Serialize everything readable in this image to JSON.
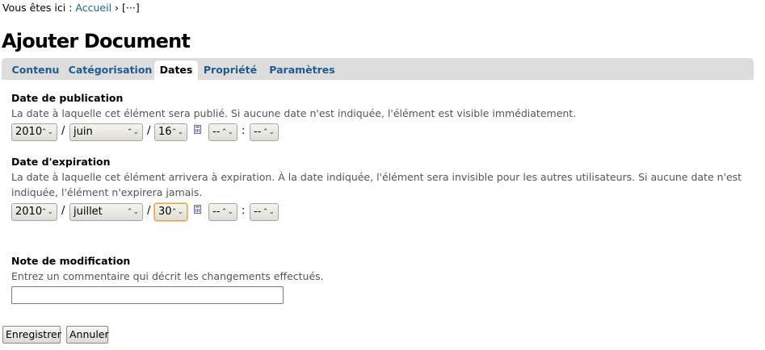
{
  "breadcrumb": {
    "prefix": "Vous êtes ici :",
    "home": "Accueil",
    "separator": "›",
    "current": "[···]"
  },
  "page_title": "Ajouter Document",
  "tabs": [
    {
      "label": "Contenu",
      "selected": false
    },
    {
      "label": "Catégorisation",
      "selected": false
    },
    {
      "label": "Dates",
      "selected": true
    },
    {
      "label": "Propriété",
      "selected": false
    },
    {
      "label": "Paramètres",
      "selected": false
    }
  ],
  "publication": {
    "label": "Date de publication",
    "help": "La date à laquelle cet élément sera publié. Si aucune date n'est indiquée, l'élément est visible immédiatement.",
    "year": "2010",
    "month": "juin",
    "day": "16",
    "hour": "--",
    "minute": "--"
  },
  "expiration": {
    "label": "Date d'expiration",
    "help": "La date à laquelle cet élément arrivera à expiration. À la date indiquée, l'élément sera invisible pour les autres utilisateurs. Si aucune date n'est indiquée, l'élément n'expirera jamais.",
    "year": "2010",
    "month": "juillet",
    "day": "30",
    "hour": "--",
    "minute": "--"
  },
  "separators": {
    "date": "/",
    "time": ":"
  },
  "arrow_glyph": "⌃⌄",
  "note": {
    "label": "Note de modification",
    "help": "Entrez un commentaire qui décrit les changements effectués.",
    "value": ""
  },
  "buttons": {
    "save": "Enregistrer",
    "cancel": "Annuler"
  },
  "colors": {
    "link": "#205c90",
    "tabbar": "#dddddd",
    "focus": "#e9a74d"
  }
}
